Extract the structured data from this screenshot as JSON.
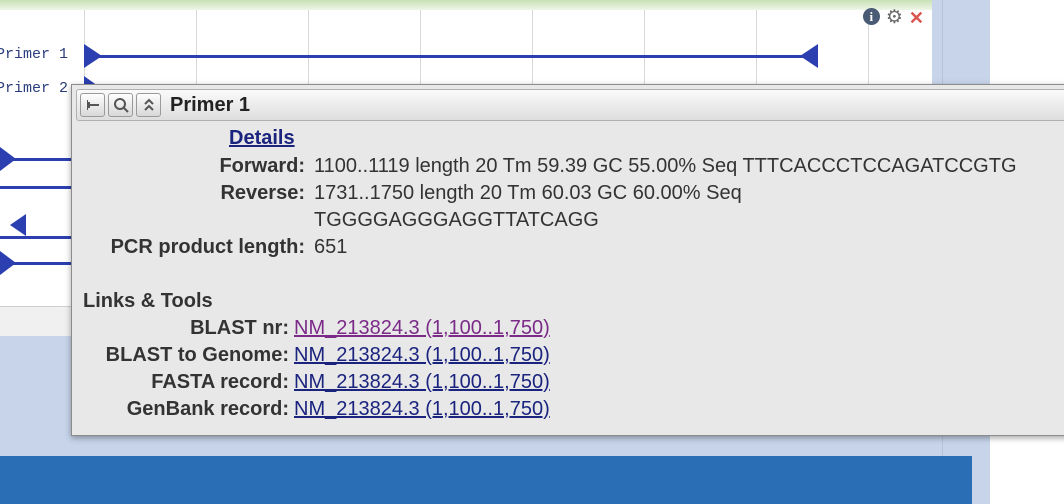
{
  "graphic": {
    "tracks": [
      {
        "label": "Primer 1"
      },
      {
        "label": "Primer 2"
      }
    ]
  },
  "popup": {
    "title": "Primer 1",
    "details_link": "Details",
    "rows": [
      {
        "label": "Forward:",
        "value": "1100..1119 length 20 Tm 59.39 GC 55.00% Seq TTTCACCCTCCAGATCCGTG"
      },
      {
        "label": "Reverse:",
        "value": "1731..1750 length 20 Tm 60.03 GC 60.00% Seq",
        "value2": "TGGGGAGGGAGGTTATCAGG"
      },
      {
        "label": "PCR product length:",
        "value": "651"
      }
    ],
    "links_heading": "Links & Tools",
    "links": [
      {
        "label": "BLAST nr:",
        "text": "NM_213824.3 (1,100..1,750)",
        "visited": true
      },
      {
        "label": "BLAST to Genome:",
        "text": "NM_213824.3 (1,100..1,750)",
        "visited": false
      },
      {
        "label": "FASTA record:",
        "text": "NM_213824.3 (1,100..1,750)",
        "visited": false
      },
      {
        "label": "GenBank record:",
        "text": "NM_213824.3 (1,100..1,750)",
        "visited": false
      }
    ]
  },
  "colors": {
    "link": "#1a237e",
    "visited_link": "#7b2a88",
    "footer": "#2a6fb5",
    "track": "#2b3fb0"
  },
  "icons": [
    "info-icon",
    "gear-icon",
    "close-icon",
    "pin-icon",
    "magnifier-icon",
    "collapse-icon"
  ]
}
